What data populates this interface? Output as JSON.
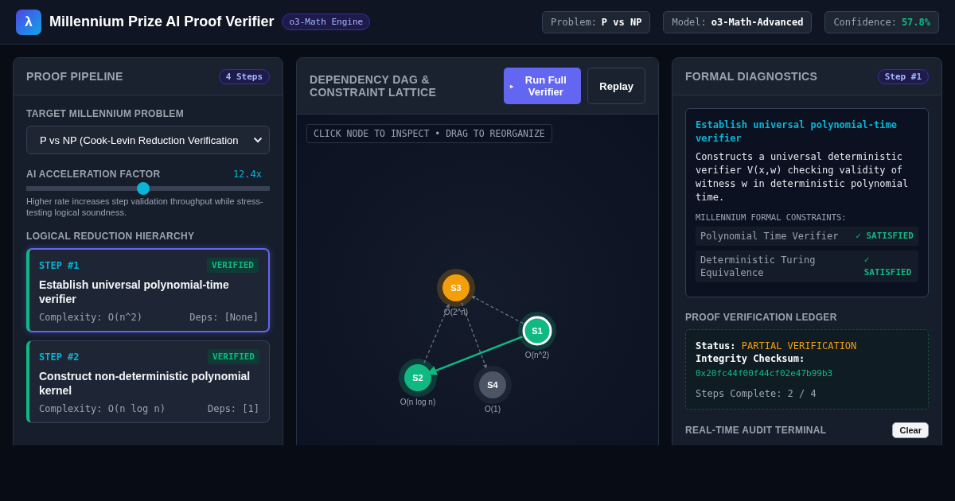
{
  "header": {
    "logo": "λ",
    "title": "Millennium Prize AI Proof Verifier",
    "engine_badge": "o3-Math Engine",
    "stats": [
      {
        "label": "Problem:",
        "value": "P vs NP",
        "kind": "plain"
      },
      {
        "label": "Model:",
        "value": "o3-Math-Advanced",
        "kind": "plain"
      },
      {
        "label": "Confidence:",
        "value": "57.8%",
        "kind": "good"
      }
    ]
  },
  "pipeline": {
    "title": "PROOF PIPELINE",
    "badge": "4 Steps",
    "problem_label": "TARGET MILLENNIUM PROBLEM",
    "problem_select": "P vs NP (Cook-Levin Reduction Verification",
    "accel": {
      "label": "AI ACCELERATION FACTOR",
      "reading": "12.4x",
      "level": 0.48,
      "hint": "Higher rate increases step validation throughput while stress-testing logical soundness."
    },
    "hierarchy_label": "LOGICAL REDUCTION HIERARCHY",
    "steps": [
      {
        "step": "STEP #1",
        "status": "VERIFIED",
        "verified": true,
        "title": "Establish universal polynomial-time verifier",
        "complexity": "Complexity: O(n^2)",
        "deps": "Deps: [None]",
        "selected": true
      },
      {
        "step": "STEP #2",
        "status": "VERIFIED",
        "verified": true,
        "title": "Construct non-deterministic polynomial kernel",
        "complexity": "Complexity: O(n log n)",
        "deps": "Deps: [1]",
        "selected": false
      }
    ]
  },
  "dag": {
    "title": "DEPENDENCY DAG & CONSTRAINT LATTICE",
    "run_icon": "▸",
    "run_button": "Run Full Verifier",
    "replay_button": "Replay",
    "hint": "CLICK NODE TO INSPECT • DRAG TO REORGANIZE",
    "nodes": [
      {
        "id": "S3",
        "complexity": "O(2^n)",
        "color": "#f59e0b",
        "selected": false
      },
      {
        "id": "S1",
        "complexity": "O(n^2)",
        "color": "#10b981",
        "selected": true
      },
      {
        "id": "S2",
        "complexity": "O(n log n)",
        "color": "#10b981",
        "selected": false
      },
      {
        "id": "S4",
        "complexity": "O(1)",
        "color": "#4b5563",
        "selected": false
      }
    ]
  },
  "diagnostics": {
    "title": "FORMAL DIAGNOSTICS",
    "badge": "Step #1",
    "detail": {
      "title": "Establish universal polynomial-time verifier",
      "description": "Constructs a universal deterministic verifier V(x,w) checking validity of witness w in deterministic polynomial time.",
      "constraints_label": "MILLENNIUM FORMAL CONSTRAINTS:",
      "constraints": [
        {
          "name": "Polynomial Time Verifier",
          "result": "✓ SATISFIED"
        },
        {
          "name": "Deterministic Turing Equivalence",
          "result": "✓ SATISFIED"
        }
      ]
    },
    "ledger": {
      "title": "PROOF VERIFICATION LEDGER",
      "status_label": "Status:",
      "status_value": "PARTIAL VERIFICATION",
      "checksum_label": "Integrity Checksum:",
      "checksum": "0x20fc44f00f44cf02e47b99b3",
      "steps_complete": "Steps Complete: 2 / 4"
    },
    "terminal": {
      "title": "REAL-TIME AUDIT TERMINAL",
      "clear": "Clear"
    }
  }
}
